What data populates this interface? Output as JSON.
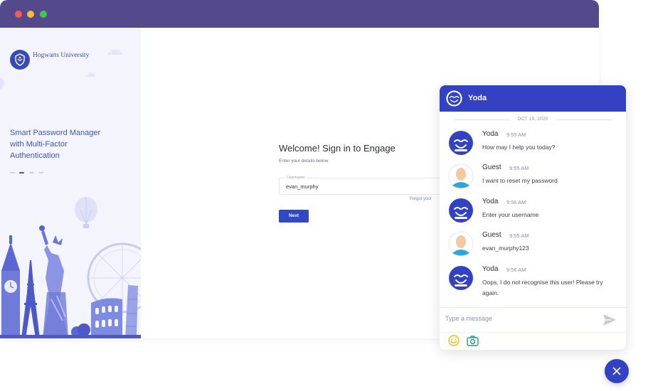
{
  "sidebar": {
    "brand": "Hogwarts University",
    "tagline": "Smart Password Manager with Multi-Factor Authentication",
    "carousel_active": 2,
    "carousel_count": 4
  },
  "login": {
    "title": "Welcome! Sign in to Engage",
    "subtitle": "Enter your details below",
    "username_label": "Username",
    "username_value": "evan_murphy",
    "forgot_link": "Forgot your",
    "next_button": "Next"
  },
  "chat": {
    "title": "Yoda",
    "date": "OCT 19, 2020",
    "messages": [
      {
        "sender": "Yoda",
        "time": "9:55 AM",
        "text": "How may I help you today?"
      },
      {
        "sender": "Guest",
        "time": "9:55 AM",
        "text": "I want to reset my password"
      },
      {
        "sender": "Yoda",
        "time": "9:56 AM",
        "text": "Enter your username"
      },
      {
        "sender": "Guest",
        "time": "9:55 AM",
        "text": "evan_murphy123"
      },
      {
        "sender": "Yoda",
        "time": "9:56 AM",
        "text": "Oops, I do not recognise this user! Please try again."
      }
    ],
    "input_placeholder": "Type a message"
  },
  "colors": {
    "titlebar": "#544a8b",
    "accent": "#3342c2",
    "sidebar_bg": "#f4f5fc",
    "emoji": "#f5b800",
    "camera": "#1aa08a"
  },
  "icons": {
    "send": "send-icon",
    "emoji": "emoji-icon",
    "camera": "camera-icon",
    "close": "close-icon"
  }
}
